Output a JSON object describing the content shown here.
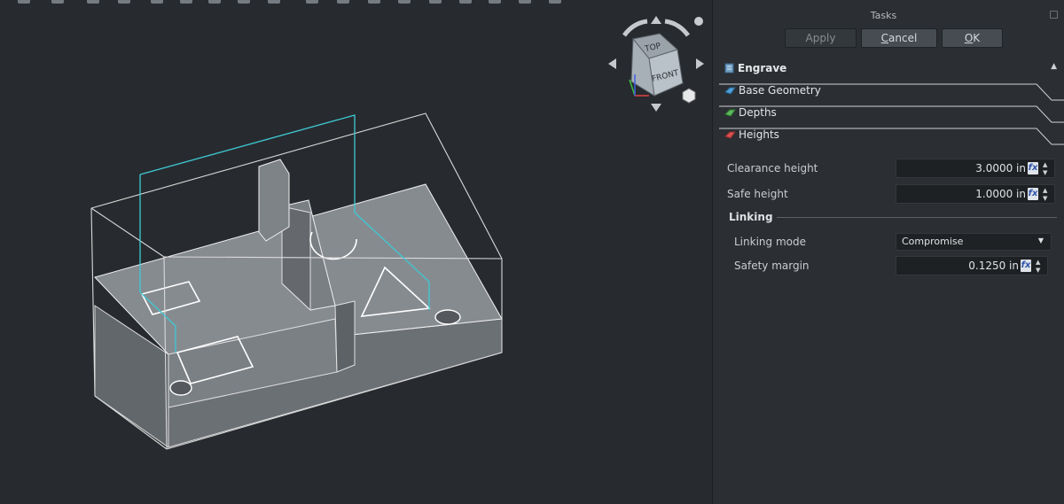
{
  "tasks_panel": {
    "title": "Tasks",
    "buttons": {
      "apply": "Apply",
      "cancel_first": "C",
      "cancel_rest": "ancel",
      "ok_first": "O",
      "ok_rest": "K"
    }
  },
  "operation": {
    "name": "Engrave"
  },
  "sections": {
    "base_geometry": "Base Geometry",
    "depths": "Depths",
    "heights": "Heights"
  },
  "heights": {
    "clearance_height": {
      "label": "Clearance height",
      "value": "3.0000 in"
    },
    "safe_height": {
      "label": "Safe height",
      "value": "1.0000 in"
    }
  },
  "linking": {
    "title": "Linking",
    "mode": {
      "label": "Linking mode",
      "value": "Compromise"
    },
    "safety_margin": {
      "label": "Safety margin",
      "value": "0.1250 in"
    }
  },
  "navcube": {
    "top_face": "TOP",
    "front_face": "FRONT"
  },
  "icons": {
    "expression": "fx",
    "spin_up": "▲",
    "spin_down": "▼",
    "collapse": "▲",
    "dropdown": "▼"
  },
  "colors": {
    "panel_background": "#2b2f33",
    "viewport_background": "#272b2f",
    "selection_highlight": "#3ec9d3",
    "model_fill": "#7d8287",
    "edge_color": "#e8e8e8"
  }
}
